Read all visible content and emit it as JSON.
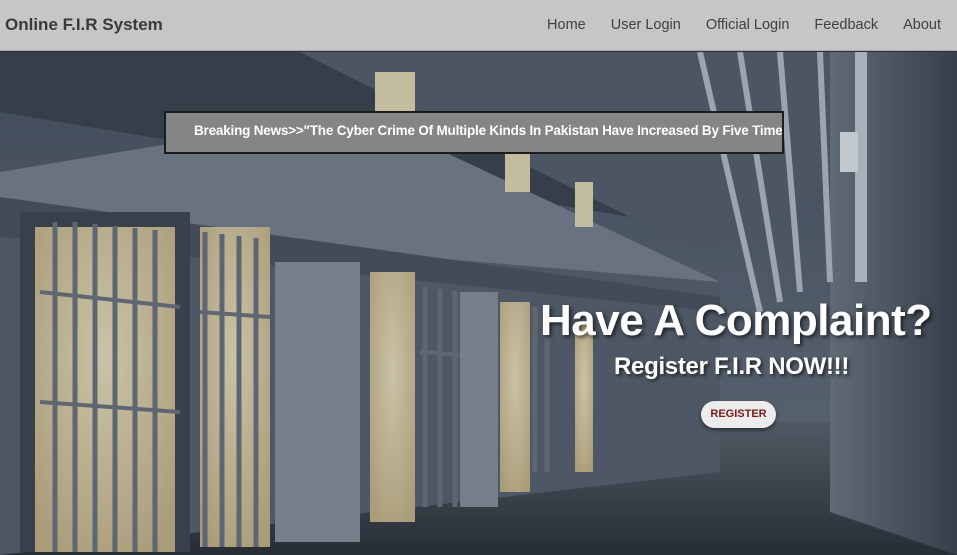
{
  "navbar": {
    "brand": "Online F.I.R System",
    "links": [
      "Home",
      "User Login",
      "Official Login",
      "Feedback",
      "About"
    ]
  },
  "ticker": {
    "text": "Breaking News>>\"The Cyber Crime Of Multiple Kinds In Pakistan Have Increased By Five Times O"
  },
  "hero": {
    "headline": "Have A Complaint?",
    "subheadline": "Register F.I.R NOW!!!",
    "register_label": "REGISTER"
  }
}
